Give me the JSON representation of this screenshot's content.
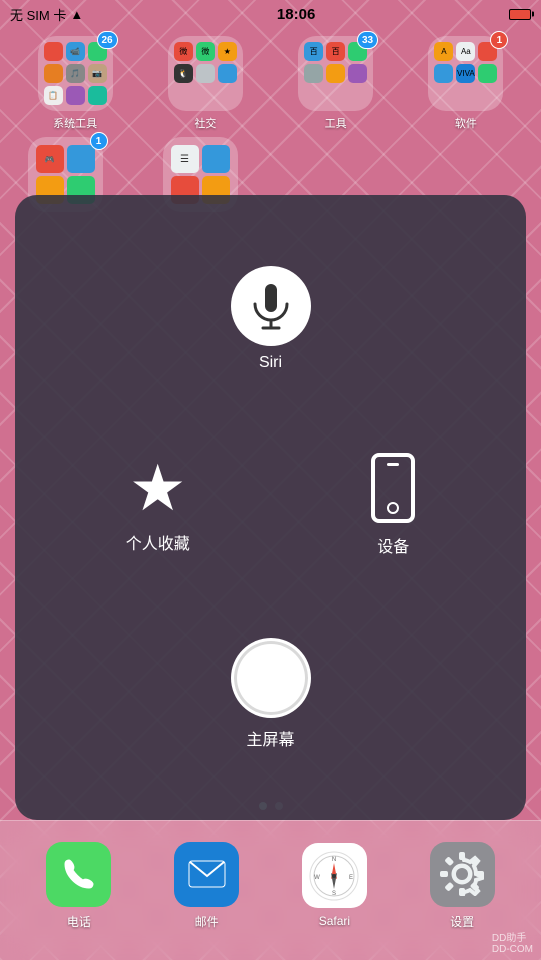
{
  "statusBar": {
    "carrier": "无 SIM 卡",
    "signal": "📶",
    "time": "18:06",
    "battery": "low"
  },
  "folders": [
    {
      "label": "系统工具",
      "badge": "26",
      "badgeColor": "blue"
    },
    {
      "label": "社交",
      "badge": null,
      "badgeColor": null
    },
    {
      "label": "工具",
      "badge": "33",
      "badgeColor": "blue"
    },
    {
      "label": "软件",
      "badge": "1",
      "badgeColor": "red"
    }
  ],
  "secondRowFolders": [
    {
      "label": "",
      "badge": "1",
      "badgeColor": "blue"
    },
    {
      "label": "",
      "badge": null
    }
  ],
  "assistiveTouch": {
    "siriLabel": "Siri",
    "favoritesLabel": "个人收藏",
    "deviceLabel": "设备",
    "homeLabel": "主屏幕"
  },
  "pageDots": [
    {
      "active": true
    },
    {
      "active": false
    }
  ],
  "dock": [
    {
      "label": "电话",
      "icon": "📞"
    },
    {
      "label": "邮件",
      "icon": "✉️"
    },
    {
      "label": "Safari",
      "icon": "🧭"
    },
    {
      "label": "设置",
      "icon": "⚙️"
    }
  ],
  "watermark": "DD助手\nDD-COM"
}
